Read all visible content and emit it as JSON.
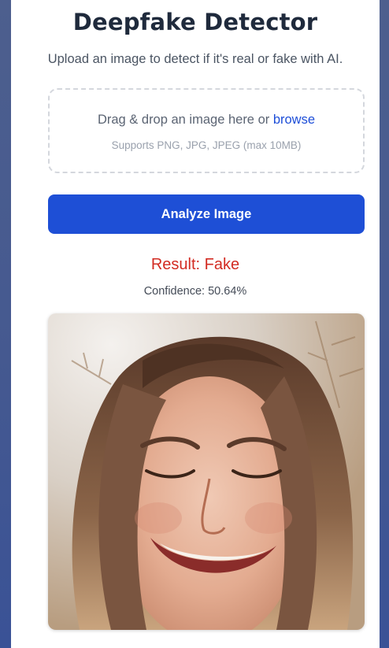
{
  "app": {
    "title": "Deepfake Detector",
    "subtitle": "Upload an image to detect if it's real or fake with AI."
  },
  "upload": {
    "prompt_text": "Drag & drop an image here or ",
    "browse_label": "browse",
    "hint": "Supports PNG, JPG, JPEG (max 10MB)"
  },
  "actions": {
    "analyze_label": "Analyze Image"
  },
  "result": {
    "label": "Result: Fake",
    "confidence": "Confidence: 50.64%"
  },
  "colors": {
    "accent": "#1e4fd6",
    "result_fake": "#d22b22",
    "link": "#1d4ed8"
  }
}
